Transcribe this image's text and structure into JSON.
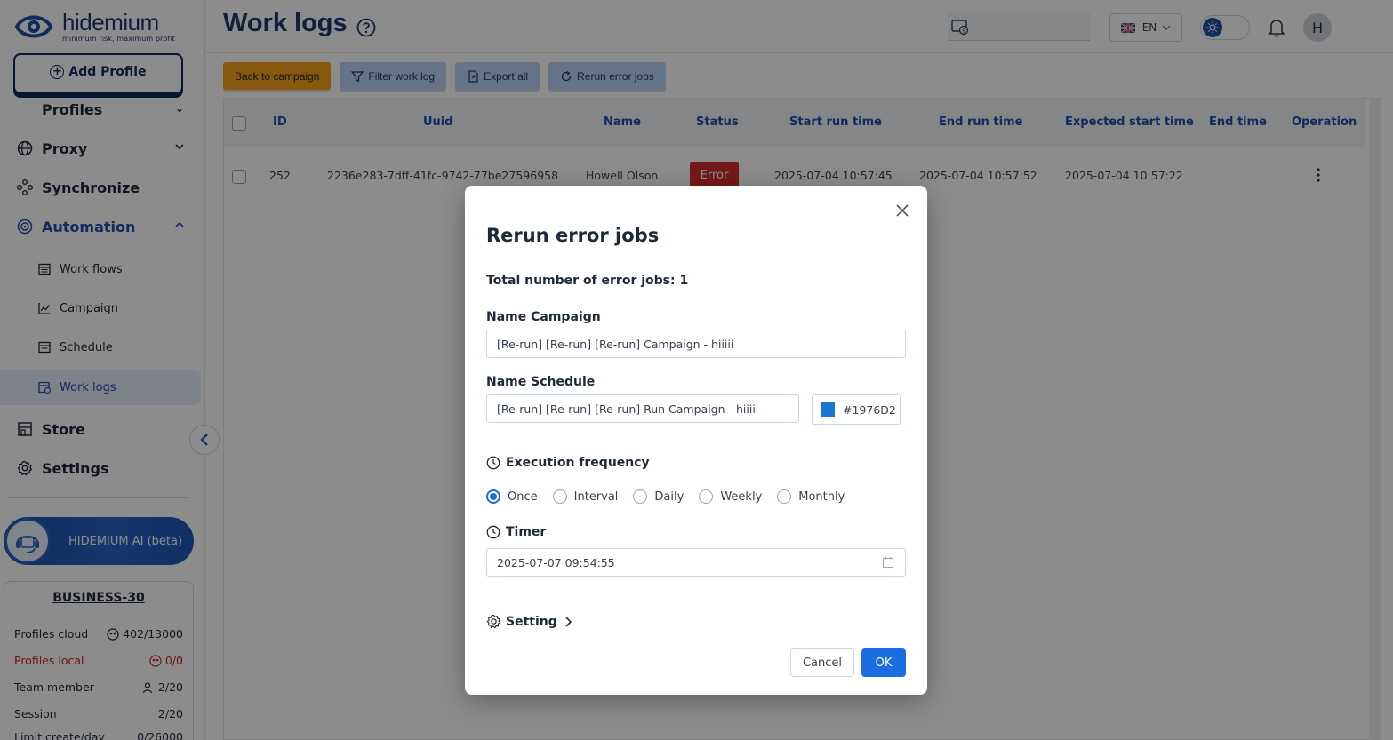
{
  "brand": {
    "name": "hidemium",
    "tagline": "minimum risk, maximum profit"
  },
  "sidebar": {
    "add_profile_label": "Add Profile",
    "items": [
      {
        "label": "Profiles"
      },
      {
        "label": "Proxy"
      },
      {
        "label": "Synchronize"
      },
      {
        "label": "Automation"
      },
      {
        "label": "Store"
      },
      {
        "label": "Settings"
      }
    ],
    "automation_sub": [
      {
        "label": "Work flows"
      },
      {
        "label": "Campaign"
      },
      {
        "label": "Schedule"
      },
      {
        "label": "Work logs"
      }
    ],
    "ai_label": "HIDEMIUM AI (beta)",
    "plan": {
      "title": "BUSINESS-30",
      "rows": [
        {
          "label": "Profiles cloud",
          "value": "402/13000"
        },
        {
          "label": "Profiles local",
          "value": "0/0"
        },
        {
          "label": "Team member",
          "value": "2/20"
        },
        {
          "label": "Session",
          "value": "2/20"
        },
        {
          "label": "Limit create/day",
          "value": "0/26000"
        }
      ]
    }
  },
  "header": {
    "title": "Work logs",
    "language": "EN",
    "avatar_initial": "H"
  },
  "toolbar": {
    "back": "Back to campaign",
    "filter": "Filter work log",
    "export": "Export all",
    "rerun": "Rerun error jobs"
  },
  "table": {
    "columns": [
      "ID",
      "Uuid",
      "Name",
      "Status",
      "Start run time",
      "End run time",
      "Expected start time",
      "End time",
      "Operation"
    ],
    "rows": [
      {
        "id": "252",
        "uuid": "2236e283-7dff-41fc-9742-77be27596958",
        "name": "Howell Olson",
        "status": "Error",
        "start": "2025-07-04 10:57:45",
        "end": "2025-07-04 10:57:52",
        "expected": "2025-07-04 10:57:22",
        "end_time": ""
      }
    ]
  },
  "modal": {
    "title": "Rerun error jobs",
    "total": "Total number of error jobs: 1",
    "campaign_label": "Name Campaign",
    "campaign_value": "[Re-run] [Re-run] [Re-run] Campaign - hiiiii",
    "schedule_label": "Name Schedule",
    "schedule_value": "[Re-run] [Re-run] [Re-run] Run Campaign - hiiiii",
    "color_value": "#1976D2",
    "frequency_label": "Execution frequency",
    "frequency_options": [
      "Once",
      "Interval",
      "Daily",
      "Weekly",
      "Monthly"
    ],
    "timer_label": "Timer",
    "timer_value": "2025-07-07 09:54:55",
    "setting_label": "Setting",
    "cancel": "Cancel",
    "ok": "OK"
  },
  "colors": {
    "accent": "#1a6fe0",
    "brand_dark": "#1e3a6e",
    "error": "#d32f2f",
    "orange": "#f5a31a"
  }
}
